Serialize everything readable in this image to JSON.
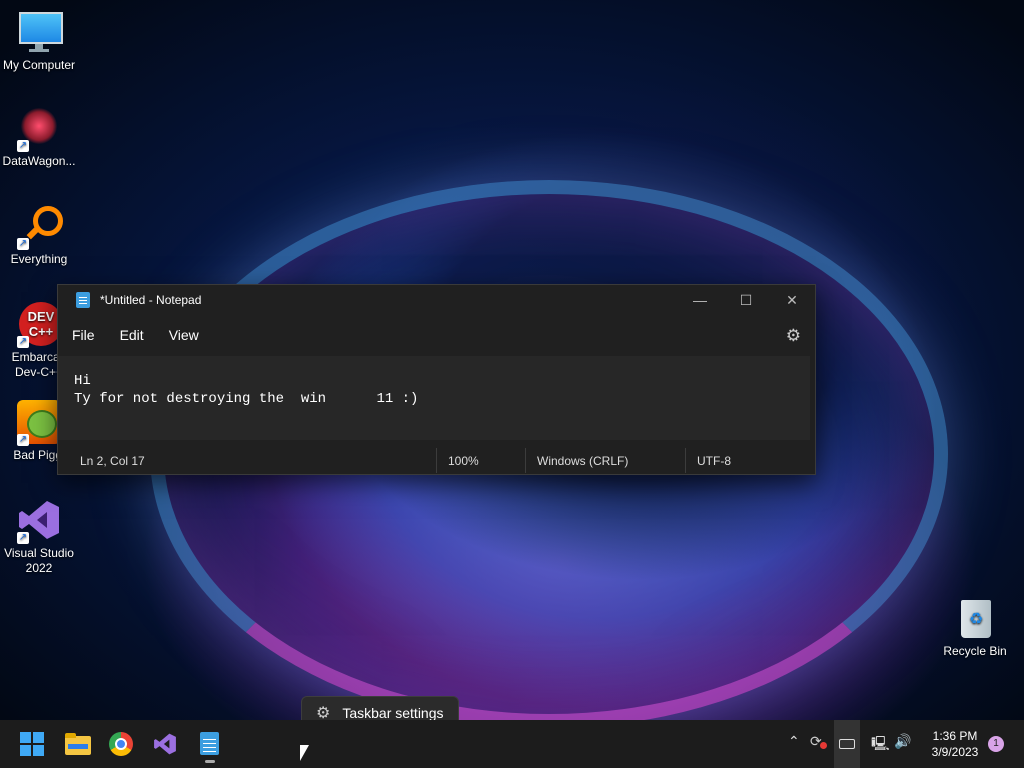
{
  "desktop": {
    "icons": [
      {
        "label": "My Computer"
      },
      {
        "label": "DataWagon..."
      },
      {
        "label": "Everything"
      },
      {
        "label": "Embarcadero Dev-C++",
        "line1": "Embarcad",
        "line2": "Dev-C++"
      },
      {
        "label": "Bad Piggies",
        "line1": "Bad Piggi"
      },
      {
        "label": "Visual Studio 2022",
        "line1": "Visual Studio",
        "line2": "2022"
      },
      {
        "label": "Recycle Bin"
      }
    ]
  },
  "notepad": {
    "title": "*Untitled - Notepad",
    "menu": [
      "File",
      "Edit",
      "View"
    ],
    "content": "Hi\nTy for not destroying the  win      11 :)",
    "status": {
      "position": "Ln 2, Col 17",
      "zoom": "100%",
      "line_ending": "Windows (CRLF)",
      "encoding": "UTF-8"
    }
  },
  "taskbar": {
    "popup_label": "Taskbar settings",
    "time": "1:36 PM",
    "date": "3/9/2023",
    "notification_count": "1"
  }
}
